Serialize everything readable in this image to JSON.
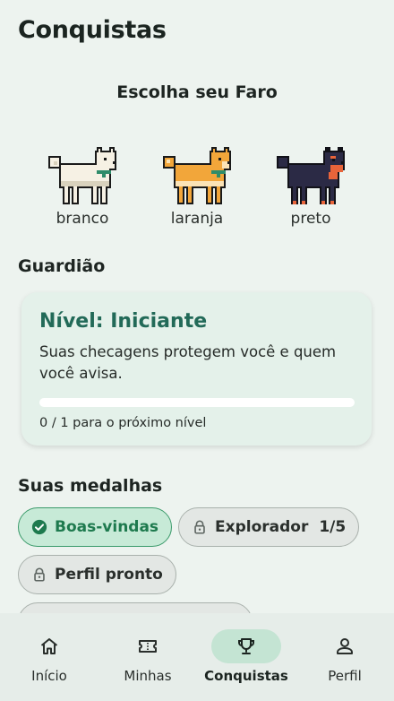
{
  "page": {
    "title": "Conquistas"
  },
  "faro": {
    "heading": "Escolha seu Faro",
    "options": [
      {
        "label": "branco",
        "color": "#f6f1e4"
      },
      {
        "label": "laranja",
        "color": "#f2a63a"
      },
      {
        "label": "preto",
        "color": "#2b2a45"
      }
    ]
  },
  "guardian": {
    "heading": "Guardião",
    "level_title": "Nível: Iniciante",
    "description": "Suas checagens protegem você e quem você avisa.",
    "progress_value": 0,
    "progress_text": "0 / 1 para o próximo nível"
  },
  "medals": {
    "heading": "Suas medalhas",
    "items": [
      {
        "label": "Boas-vindas",
        "status": "earned",
        "icon": "check-circle-icon"
      },
      {
        "label": "Explorador",
        "status": "locked",
        "progress": "1/5",
        "icon": "lock-icon"
      },
      {
        "label": "Perfil pronto",
        "status": "locked",
        "icon": "lock-icon"
      }
    ]
  },
  "nav": {
    "items": [
      {
        "label": "Início",
        "icon": "home-icon"
      },
      {
        "label": "Minhas",
        "icon": "ticket-icon"
      },
      {
        "label": "Conquistas",
        "icon": "trophy-icon",
        "active": true
      },
      {
        "label": "Perfil",
        "icon": "person-icon"
      }
    ]
  },
  "colors": {
    "background": "#edf3ef",
    "accent": "#226a58",
    "earned": "#1e7a4e"
  }
}
